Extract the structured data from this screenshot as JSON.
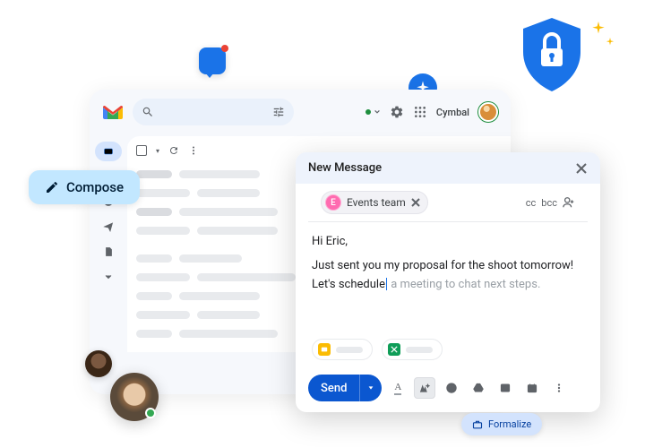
{
  "header": {
    "brand_name": "Cymbal"
  },
  "compose_button": {
    "label": "Compose"
  },
  "compose_window": {
    "title": "New Message",
    "recipient": {
      "initial": "E",
      "name": "Events team"
    },
    "cc_label": "cc",
    "bcc_label": "bcc",
    "body": {
      "greeting": "Hi Eric,",
      "line1": "Just sent you my proposal for the shoot tomorrow!",
      "line2_typed": "Let's schedule",
      "line2_suggestion": " a meeting to chat next steps."
    },
    "send_label": "Send"
  },
  "formalize": {
    "label": "Formalize"
  }
}
